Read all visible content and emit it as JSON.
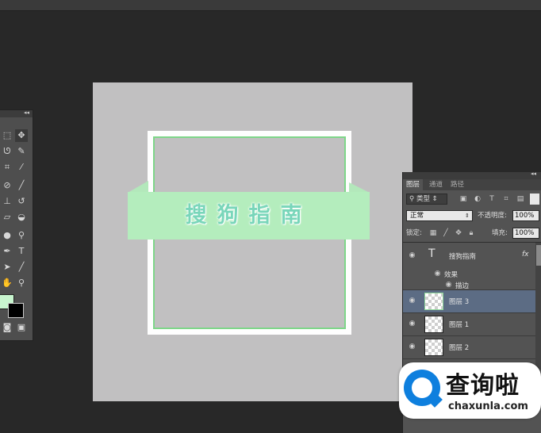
{
  "canvas": {
    "banner_text": "搜狗指南",
    "colors": {
      "canvas_bg": "#c1c0c1",
      "frame_white": "#fefefe",
      "frame_green": "#7ed689",
      "ribbon": "#b4edbd",
      "ribbon_text": "#79d6ba"
    }
  },
  "toolbox": {
    "collapse_glyph": "◂◂",
    "tools": [
      "marquee-icon",
      "move-icon",
      "lasso-icon",
      "quick-select-icon",
      "crop-icon",
      "eyedropper-icon",
      "healing-icon",
      "brush-icon",
      "stamp-icon",
      "history-brush-icon",
      "eraser-icon",
      "paint-bucket-icon",
      "blur-icon",
      "dodge-icon",
      "pen-icon",
      "text-icon",
      "path-select-icon",
      "line-icon",
      "hand-icon",
      "zoom-icon"
    ],
    "text_tool_glyph": "T",
    "foreground_color": "#c8f5cf",
    "background_color": "#000000"
  },
  "layers_panel": {
    "collapse_glyph": "◂◂",
    "tabs": [
      "图层",
      "通道",
      "路径"
    ],
    "filter_label": "类型",
    "blend_mode": "正常",
    "opacity_label": "不透明度:",
    "opacity_value": "100%",
    "lock_label": "锁定:",
    "fill_label": "填充:",
    "fill_value": "100%",
    "layers": [
      {
        "name": "搜狗指南",
        "type_glyph": "T",
        "fx": "fx"
      },
      {
        "name": "效果"
      },
      {
        "name": "描边"
      },
      {
        "name": "图层 3",
        "selected": true
      },
      {
        "name": "图层 1"
      },
      {
        "name": "图层 2"
      }
    ]
  },
  "watermark": {
    "title": "查询啦",
    "url": "chaxunla.com",
    "accent": "#0e7fde"
  }
}
